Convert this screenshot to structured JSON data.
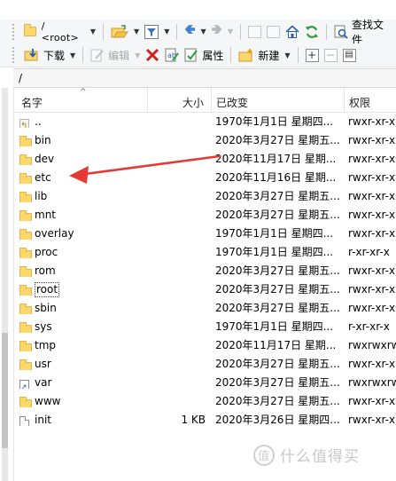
{
  "toolbar1": {
    "path_combo_text": "/ <root>",
    "search_files_label": "查找文件"
  },
  "toolbar2": {
    "download_label": "下载",
    "edit_label": "编辑",
    "properties_label": "属性",
    "new_label": "新建"
  },
  "path_bar": "/",
  "columns": {
    "name": "名字",
    "size": "大小",
    "modified": "已改变",
    "permissions": "权限"
  },
  "files": [
    {
      "name": "..",
      "size": "",
      "modified": "1970年1月1日 星期四...",
      "permissions": "rwxr-xr-x",
      "icon": "up-folder-icon"
    },
    {
      "name": "bin",
      "size": "",
      "modified": "2020年3月27日 星期五...",
      "permissions": "rwxr-xr-x",
      "icon": "folder-icon"
    },
    {
      "name": "dev",
      "size": "",
      "modified": "2020年11月17日 星期...",
      "permissions": "rwxr-xr-x",
      "icon": "folder-icon"
    },
    {
      "name": "etc",
      "size": "",
      "modified": "2020年11月16日 星期...",
      "permissions": "rwxr-xr-x",
      "icon": "folder-icon"
    },
    {
      "name": "lib",
      "size": "",
      "modified": "2020年3月27日 星期五...",
      "permissions": "rwxr-xr-x",
      "icon": "folder-icon"
    },
    {
      "name": "mnt",
      "size": "",
      "modified": "2020年3月27日 星期五...",
      "permissions": "rwxr-xr-x",
      "icon": "folder-icon"
    },
    {
      "name": "overlay",
      "size": "",
      "modified": "1970年1月1日 星期四...",
      "permissions": "rwxr-xr-x",
      "icon": "folder-icon"
    },
    {
      "name": "proc",
      "size": "",
      "modified": "1970年1月1日 星期四...",
      "permissions": "r-xr-xr-x",
      "icon": "folder-icon"
    },
    {
      "name": "rom",
      "size": "",
      "modified": "2020年3月27日 星期五...",
      "permissions": "rwxr-xr-x",
      "icon": "folder-icon"
    },
    {
      "name": "root",
      "size": "",
      "modified": "2020年3月27日 星期五...",
      "permissions": "rwxr-xr-x",
      "icon": "folder-icon"
    },
    {
      "name": "sbin",
      "size": "",
      "modified": "2020年3月27日 星期五...",
      "permissions": "rwxr-xr-x",
      "icon": "folder-icon"
    },
    {
      "name": "sys",
      "size": "",
      "modified": "1970年1月1日 星期四...",
      "permissions": "r-xr-xr-x",
      "icon": "folder-icon"
    },
    {
      "name": "tmp",
      "size": "",
      "modified": "2020年11月17日 星期...",
      "permissions": "rwxrwxrw",
      "icon": "folder-icon"
    },
    {
      "name": "usr",
      "size": "",
      "modified": "2020年3月27日 星期五...",
      "permissions": "rwxr-xr-x",
      "icon": "folder-icon"
    },
    {
      "name": "var",
      "size": "",
      "modified": "2020年3月27日 星期五...",
      "permissions": "rwxrwxrwx",
      "icon": "link-icon"
    },
    {
      "name": "www",
      "size": "",
      "modified": "2020年3月27日 星期五...",
      "permissions": "rwxr-xr-x",
      "icon": "folder-icon"
    },
    {
      "name": "init",
      "size": "1 KB",
      "modified": "2020年3月26日 星期四...",
      "permissions": "rwxr-xr-x",
      "icon": "file-icon"
    }
  ],
  "selected_name": "root",
  "watermark": "什么值得买",
  "colors": {
    "folder": "#fcd76c",
    "annotation_arrow": "#e53935",
    "nav_blue": "#3f7fd1",
    "refresh_green": "#2e9a3a"
  }
}
